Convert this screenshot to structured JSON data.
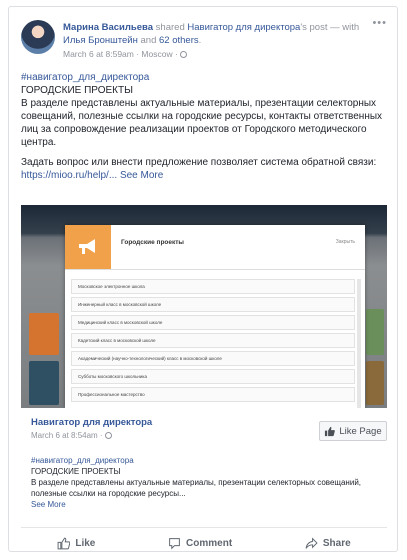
{
  "post": {
    "author": "Марина Васильева",
    "shared_text": " shared ",
    "page_name": "Навигатор для директора",
    "post_suffix": "'s post — with ",
    "with_user": "Илья Бронштейн",
    "and_text": " and ",
    "others": "62 others",
    "meta": "March 6 at 8:59am · Moscow · ",
    "more_icon": "•••"
  },
  "content": {
    "hashtag": "#навигатор_для_директора",
    "heading": "ГОРОДСКИЕ ПРОЕКТЫ",
    "paragraph1": "В разделе представлены актуальные материалы, презентации селекторных совещаний, полезные ссылки на городские ресурсы, контакты ответственных лиц за сопровождение реализации проектов от Городского методического центра.",
    "paragraph2_prefix": "Задать вопрос или внести предложение позволяет система обратной связи: ",
    "link": "https://mioo.ru/help/",
    "see_more": "... See More"
  },
  "media": {
    "dialog_title": "Городские проекты",
    "dialog_close": "Закрыть",
    "rows": [
      "Московское электронное школа",
      "Инженерный класс в московской школе",
      "Медицинский класс в московской школе",
      "Кадетский класс в московской школе",
      "Академический (научно-технологический) класс в московской школе",
      "Субботы московского школьника",
      "Профессиональное мастерство"
    ]
  },
  "shared": {
    "page": "Навигатор для директора",
    "meta": "March 6 at 8:54am · ",
    "like_page": "Like Page",
    "hashtag": "#навигатор_для_директора",
    "heading": "ГОРОДСКИЕ ПРОЕКТЫ",
    "text": "В разделе представлены актуальные материалы, презентации селекторных совещаний, полезные ссылки на городские ресурсы...",
    "see_more": "See More"
  },
  "actions": {
    "like": "Like",
    "comment": "Comment",
    "share": "Share"
  },
  "colors": {
    "link": "#365899",
    "accent": "#f0a14a",
    "muted": "#90949c"
  }
}
